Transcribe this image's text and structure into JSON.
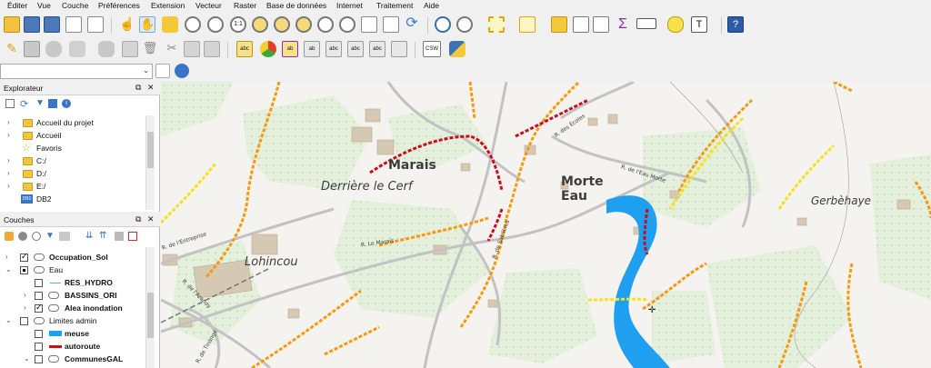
{
  "menu": [
    "Éditer",
    "Vue",
    "Couche",
    "Préférences",
    "Extension",
    "Vecteur",
    "Raster",
    "Base de données",
    "Internet",
    "Traitement",
    "Aide"
  ],
  "explorer": {
    "title": "Explorateur",
    "items": [
      {
        "label": "Accueil du projet",
        "icon": "folder-icon"
      },
      {
        "label": "Accueil",
        "icon": "folder-icon"
      },
      {
        "label": "Favoris",
        "icon": "star-icon"
      },
      {
        "label": "C:/",
        "icon": "folder-icon"
      },
      {
        "label": "D:/",
        "icon": "folder-icon"
      },
      {
        "label": "E:/",
        "icon": "folder-icon"
      },
      {
        "label": "DB2",
        "icon": "db2-icon"
      }
    ]
  },
  "layers": {
    "title": "Couches",
    "items": [
      {
        "label": "Occupation_Sol",
        "bold": true
      },
      {
        "label": "Eau",
        "bold": false
      },
      {
        "label": "RES_HYDRO",
        "bold": true
      },
      {
        "label": "BASSINS_ORI",
        "bold": true
      },
      {
        "label": "Alea inondation",
        "bold": true
      },
      {
        "label": "Limites admin",
        "bold": false
      },
      {
        "label": "meuse",
        "bold": true
      },
      {
        "label": "autoroute",
        "bold": true
      },
      {
        "label": "CommunesGAL",
        "bold": true
      }
    ]
  },
  "map_labels": {
    "marais": "Marais",
    "derriere": "Derrière le Cerf",
    "morte1": "Morte",
    "morte2": "Eau",
    "gerbehaye": "Gerbèhaye",
    "lohincou": "Lohincou",
    "rue_marais": "R. Le Marais",
    "rue_pirettes": "R. de l'Entreprise",
    "rue_ecoles": "R. des Écoles",
    "rue_eau_morte": "R. de l'Eau Morte",
    "rue_sablieres": "R. de Sablières",
    "rue_tinange": "R. de Tinange",
    "rue_aranoy": "R. de l'Aranoy"
  },
  "colors": {
    "river": "#1e9ff0",
    "autoroute": "#c80e1e",
    "alea_orange": "#f59a0e",
    "alea_yellow": "#f6e21a",
    "road": "#bdbdbd"
  }
}
